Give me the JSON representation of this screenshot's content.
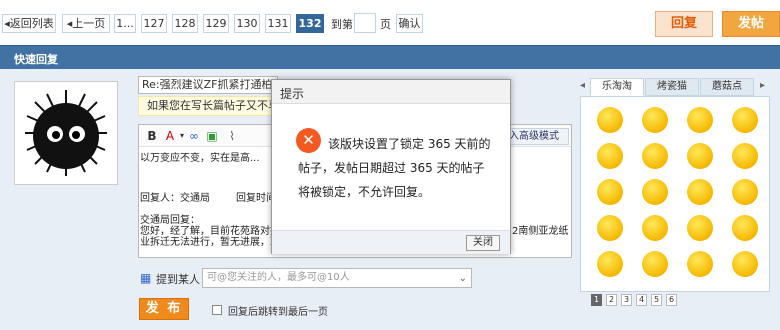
{
  "pager": {
    "back_to_list": "返回列表",
    "prev": "上一页",
    "first": "1...",
    "pages": [
      "127",
      "128",
      "129",
      "130",
      "131",
      "132"
    ],
    "current": "132",
    "goto_prefix": "到第",
    "goto_suffix": "页",
    "confirm": "确认"
  },
  "actions": {
    "reply": "回复",
    "post": "发帖"
  },
  "quick_reply": {
    "title": "快速回复",
    "subject": "Re:强烈建议ZF抓紧打通柏阿路",
    "notice": "如果您在写长篇帖子又不马上",
    "advanced_mode": "入高级模式",
    "content_lines": [
      "以万变应不变，实在是高...",
      "回复人：交通局",
      "回复时间",
      "交通局回复：",
      "您好，经了解，目前花苑路对接",
      "业拆迁无法进行，暂无进展，耳",
      "2南侧亚龙纸"
    ],
    "mention_label": "提到某人：",
    "mention_placeholder": "可@您关注的人，最多可@10人",
    "submit": "发 布",
    "jump_label": "回复后跳转到最后一页"
  },
  "smiley": {
    "tabs": [
      "乐淘淘",
      "烤瓷猫",
      "蘑菇点"
    ],
    "active_tab": "乐淘淘",
    "pages": [
      "1",
      "2",
      "3",
      "4",
      "5",
      "6"
    ],
    "active_page": "1",
    "count": 20
  },
  "modal": {
    "title": "提示",
    "message": "该版块设置了锁定 365 天前的帖子，发帖日期超过 365 天的帖子将被锁定，不允许回复。",
    "close": "关闭"
  },
  "colors": {
    "accent": "#336699",
    "header": "#4272a3",
    "orange": "#f08a1c"
  }
}
